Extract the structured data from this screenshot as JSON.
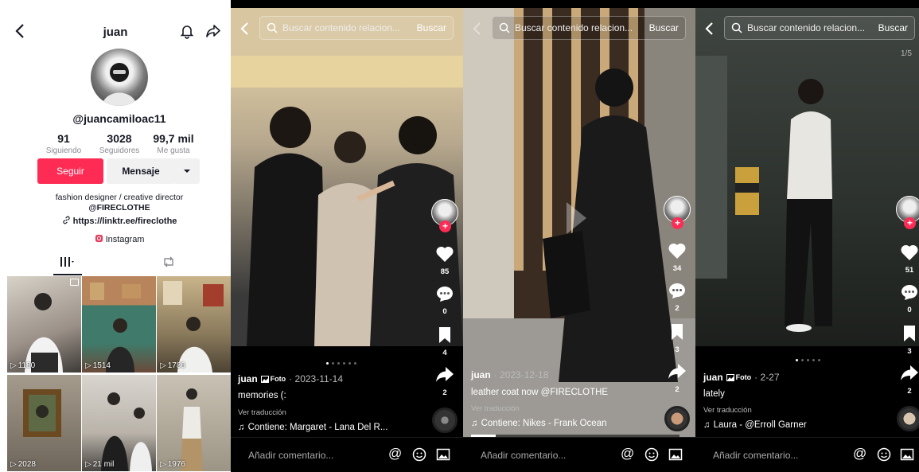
{
  "profile": {
    "title": "juan",
    "handle": "@juancamiloac11",
    "stats": [
      {
        "value": "91",
        "label": "Siguiendo"
      },
      {
        "value": "3028",
        "label": "Seguidores"
      },
      {
        "value": "99,7 mil",
        "label": "Me gusta"
      }
    ],
    "follow_label": "Seguir",
    "message_label": "Mensaje",
    "bio_line1": "fashion designer / creative director",
    "bio_line2": "@FIRECLOTHE",
    "link": "https://linktr.ee/fireclothe",
    "instagram": "Instagram",
    "grid": [
      {
        "views": "1180",
        "multi": true
      },
      {
        "views": "1514",
        "multi": false
      },
      {
        "views": "1786",
        "multi": false
      },
      {
        "views": "2028",
        "multi": false
      },
      {
        "views": "21 mil",
        "multi": false
      },
      {
        "views": "1976",
        "multi": false
      }
    ]
  },
  "search": {
    "placeholder": "Buscar contenido relacion...",
    "button": "Buscar"
  },
  "videos": [
    {
      "user": "juan",
      "tag": "Foto",
      "date": "2023-11-14",
      "caption": "memories (:",
      "translate": "Ver traducción",
      "music": "Contiene: Margaret - Lana Del R...",
      "likes": "85",
      "comments": "0",
      "saves": "4",
      "shares": "2"
    },
    {
      "user": "juan",
      "tag": "",
      "date": "2023-12-18",
      "caption": "leather coat now @FIRECLOTHE",
      "translate": "Ver traducción",
      "music": "Contiene: Nikes - Frank Ocean",
      "likes": "34",
      "comments": "2",
      "saves": "3",
      "shares": "2"
    },
    {
      "user": "juan",
      "tag": "Foto",
      "date": "2-27",
      "caption": "lately",
      "translate": "Ver traducción",
      "music": "Laura - @Erroll Garner",
      "likes": "51",
      "comments": "0",
      "saves": "3",
      "shares": "2",
      "counter": "1/5"
    }
  ],
  "comment_placeholder": "Añadir comentario...",
  "colors": {
    "accent": "#fe2c55",
    "text": "#161823",
    "muted": "#8a8b91"
  }
}
